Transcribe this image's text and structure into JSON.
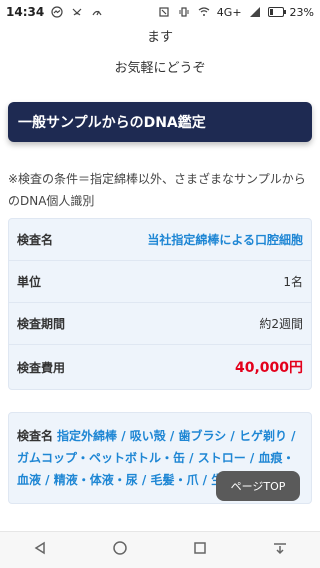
{
  "statusbar": {
    "time": "14:34",
    "network_text": "4G+",
    "battery_text": "23%",
    "battery_level": 0.23,
    "icons": [
      "messenger-icon",
      "missed-call-icon",
      "data-speed-icon",
      "nfc-icon",
      "vibrate-icon",
      "wifi-icon",
      "signal-icon",
      "battery-icon"
    ]
  },
  "intro": {
    "line1": "ます",
    "line2": "お気軽にどうぞ"
  },
  "header": {
    "title": "一般サンプルからのDNA鑑定"
  },
  "note": {
    "text": "※検査の条件＝指定綿棒以外、さまざまなサンプルからのDNA個人識別"
  },
  "table1": {
    "rows": [
      {
        "label": "検査名",
        "value": "当社指定綿棒による口腔細胞"
      },
      {
        "label": "単位",
        "value": "1名"
      },
      {
        "label": "検査期間",
        "value": "約2週間"
      },
      {
        "label": "検査費用",
        "value": "40,000円"
      }
    ]
  },
  "table2": {
    "label": "検査名",
    "items": "指定外綿棒 / 吸い殻 / 歯ブラシ / ヒゲ剃り / ガムコップ・ペットボトル・缶 / ストロー / 血痕・血液 / 精液・体液・尿 / 毛髪・爪 / 生理用品"
  },
  "top_button": {
    "label": "ページTOP"
  },
  "navbar": {
    "items": [
      "back-icon",
      "home-icon",
      "recents-icon",
      "download-icon"
    ]
  },
  "colors": {
    "accent_blue": "#1e86d4",
    "header_bg": "#1e2a52",
    "price_red": "#e3001b",
    "table_bg": "#eef4fb"
  }
}
